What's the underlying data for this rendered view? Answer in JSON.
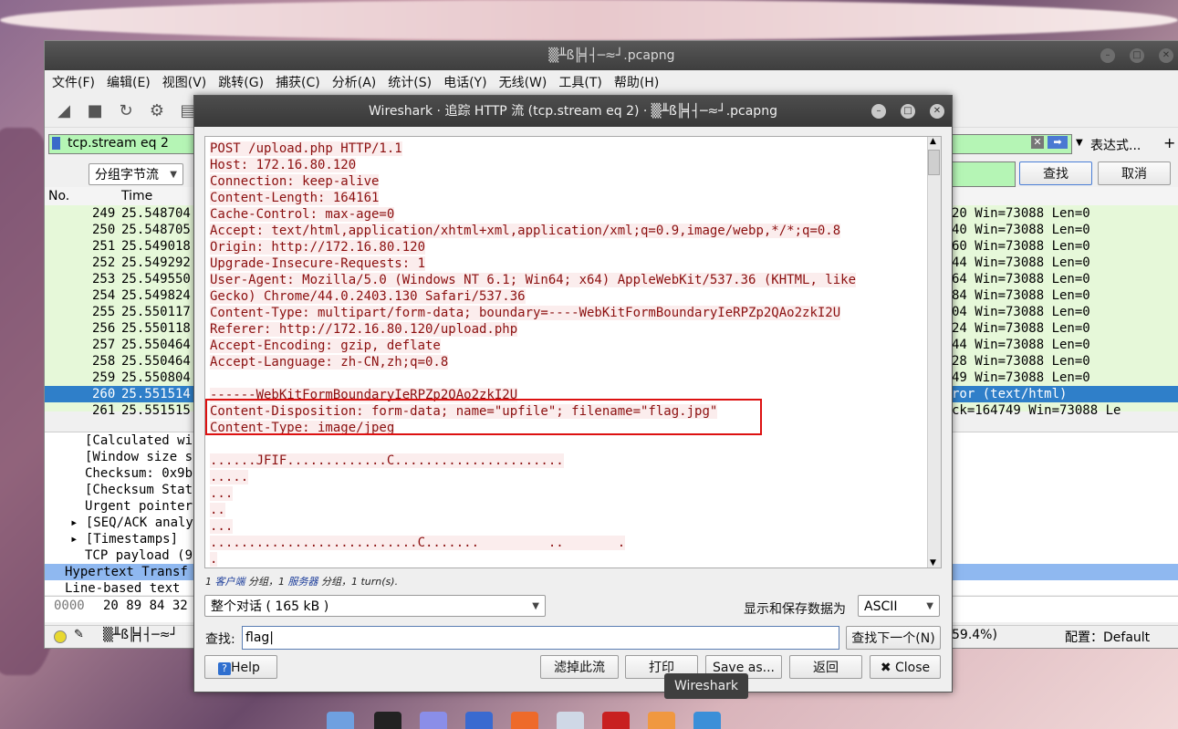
{
  "main_window": {
    "title": "▒╨ß╠╡┤─≈┘.pcapng",
    "menu": [
      "文件(F)",
      "编辑(E)",
      "视图(V)",
      "跳转(G)",
      "捕获(C)",
      "分析(A)",
      "统计(S)",
      "电话(Y)",
      "无线(W)",
      "工具(T)",
      "帮助(H)"
    ],
    "filter_value": "tcp.stream eq 2",
    "expression_label": "表达式...",
    "plus_label": "+",
    "group_dropdown": "分组字节流",
    "find_button": "查找",
    "cancel_button": "取消",
    "col_no": "No.",
    "col_time": "Time",
    "packets": [
      {
        "no": "249",
        "time": "25.548704",
        "tail": "20  Win=73088 Len=0"
      },
      {
        "no": "250",
        "time": "25.548705",
        "tail": "40  Win=73088 Len=0"
      },
      {
        "no": "251",
        "time": "25.549018",
        "tail": "60  Win=73088 Len=0"
      },
      {
        "no": "252",
        "time": "25.549292",
        "tail": "44  Win=73088 Len=0"
      },
      {
        "no": "253",
        "time": "25.549550",
        "tail": "64  Win=73088 Len=0"
      },
      {
        "no": "254",
        "time": "25.549824",
        "tail": "84  Win=73088 Len=0"
      },
      {
        "no": "255",
        "time": "25.550117",
        "tail": "04  Win=73088 Len=0"
      },
      {
        "no": "256",
        "time": "25.550118",
        "tail": "24  Win=73088 Len=0"
      },
      {
        "no": "257",
        "time": "25.550464",
        "tail": "44  Win=73088 Len=0"
      },
      {
        "no": "258",
        "time": "25.550464",
        "tail": "28  Win=73088 Len=0"
      },
      {
        "no": "259",
        "time": "25.550804",
        "tail": "49  Win=73088 Len=0"
      },
      {
        "no": "260",
        "time": "25.551514",
        "tail": "ror  (text/html)"
      },
      {
        "no": "261",
        "time": "25.551515",
        "tail": "ck=164749 Win=73088 Le"
      }
    ],
    "details": [
      "[Calculated wi",
      "[Window size s",
      "Checksum: 0x9b",
      "[Checksum Stat",
      "Urgent pointer",
      "▸ [SEQ/ACK analy",
      "▸ [Timestamps]",
      "TCP payload (9",
      "Hypertext Transf",
      "Line-based text"
    ],
    "hex_offset": "0000",
    "hex_bytes": "20 89 84 32",
    "status_file": "▒╨ß╠╡┤─≈┘",
    "status_percent": "59.4%)",
    "status_profile": "配置：Default"
  },
  "dialog": {
    "title": "Wireshark · 追踪 HTTP 流 (tcp.stream eq 2) · ▒╨ß╠╡┤─≈┘.pcapng",
    "lines": [
      "POST /upload.php HTTP/1.1",
      "Host: 172.16.80.120",
      "Connection: keep-alive",
      "Content-Length: 164161",
      "Cache-Control: max-age=0",
      "Accept: text/html,application/xhtml+xml,application/xml;q=0.9,image/webp,*/*;q=0.8",
      "Origin: http://172.16.80.120",
      "Upgrade-Insecure-Requests: 1",
      "User-Agent: Mozilla/5.0 (Windows NT 6.1; Win64; x64) AppleWebKit/537.36 (KHTML, like",
      "Gecko) Chrome/44.0.2403.130 Safari/537.36",
      "Content-Type: multipart/form-data; boundary=----WebKitFormBoundaryIeRPZp2QAo2zkI2U",
      "Referer: http://172.16.80.120/upload.php",
      "Accept-Encoding: gzip, deflate",
      "Accept-Language: zh-CN,zh;q=0.8",
      "",
      "------WebKitFormBoundaryIeRPZp2QAo2zkI2U",
      "Content-Disposition: form-data; name=\"upfile\"; filename=\"flag.jpg\"",
      "Content-Type: image/jpeg",
      "",
      "......JFIF.............C......................",
      ".....",
      "...",
      "..",
      "...",
      "...........................C.......         ..       .",
      "."
    ],
    "summary_pre": "1 ",
    "summary_client": "客户端",
    "summary_mid": " 分组，1 ",
    "summary_server": "服务器",
    "summary_post": " 分组，1 turn(s).",
    "conversation": "整个对话 ( 165 kB )",
    "show_as_label": "显示和保存数据为",
    "encoding": "ASCII",
    "find_label": "查找:",
    "find_value": "flag",
    "find_next": "查找下一个(N)",
    "help": "Help",
    "filter_out": "滤掉此流",
    "print": "打印",
    "save_as": "Save as...",
    "back": "返回",
    "close": "Close"
  },
  "tooltip": "Wireshark"
}
